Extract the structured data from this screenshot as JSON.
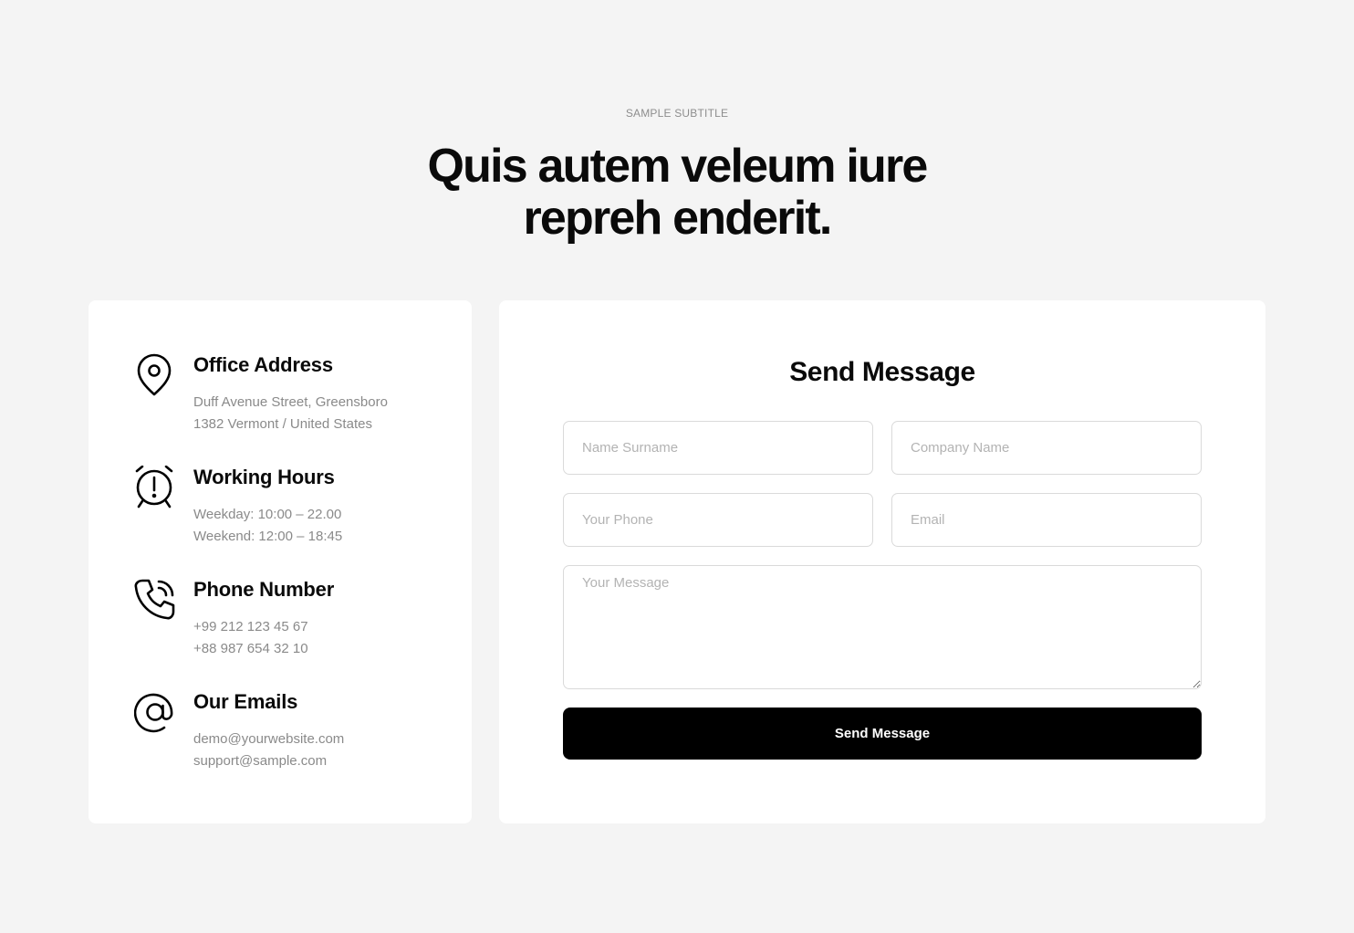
{
  "header": {
    "subtitle": "SAMPLE SUBTITLE",
    "title_line1": "Quis autem veleum iure",
    "title_line2": "repreh enderit."
  },
  "info": {
    "items": [
      {
        "icon": "location-pin-icon",
        "title": "Office Address",
        "line1": "Duff Avenue Street, Greensboro",
        "line2": "1382 Vermont / United States"
      },
      {
        "icon": "alarm-clock-icon",
        "title": "Working Hours",
        "line1": "Weekday: 10:00 – 22.00",
        "line2": "Weekend: 12:00 – 18:45"
      },
      {
        "icon": "phone-ringing-icon",
        "title": "Phone Number",
        "line1": "+99 212 123 45 67",
        "line2": "+88 987 654 32 10"
      },
      {
        "icon": "at-sign-icon",
        "title": "Our Emails",
        "line1": "demo@yourwebsite.com",
        "line2": "support@sample.com"
      }
    ]
  },
  "form": {
    "title": "Send Message",
    "name_placeholder": "Name Surname",
    "company_placeholder": "Company Name",
    "phone_placeholder": "Your Phone",
    "email_placeholder": "Email",
    "message_placeholder": "Your Message",
    "submit_label": "Send Message"
  },
  "colors": {
    "page_background": "#f4f4f4",
    "card_background": "#ffffff",
    "button_background": "#000000",
    "muted_text": "#8a8a8a"
  }
}
